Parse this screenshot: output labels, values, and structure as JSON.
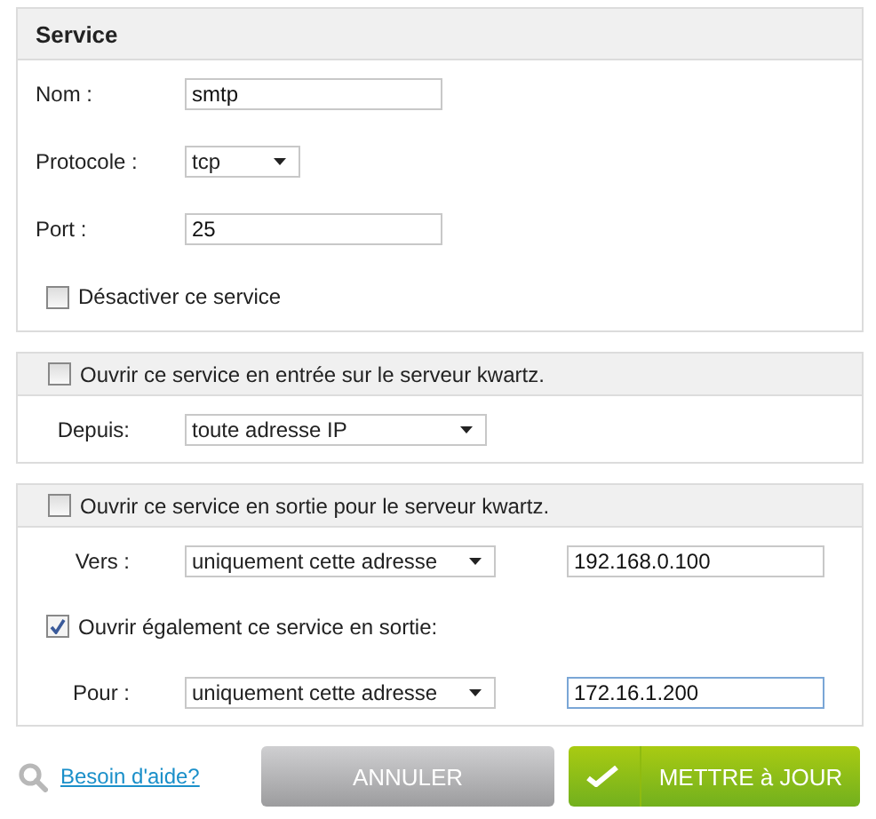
{
  "service_panel": {
    "title": "Service",
    "fields": [
      {
        "kind": "text",
        "label": "Nom :",
        "value": "smtp"
      },
      {
        "kind": "select",
        "label": "Protocole :",
        "value": "tcp"
      },
      {
        "kind": "text",
        "label": "Port :",
        "value": "25"
      }
    ],
    "disable_checkbox": {
      "label": "Désactiver ce service",
      "checked": false
    }
  },
  "inbound_panel": {
    "checkbox": {
      "label": "Ouvrir ce service en entrée sur le serveur kwartz.",
      "checked": false
    },
    "rows": [
      {
        "kind": "source",
        "label": "Depuis:",
        "select": "toute adresse IP"
      }
    ]
  },
  "outbound_panel": {
    "checkbox": {
      "label": "Ouvrir ce service en sortie pour le serveur kwartz.",
      "checked": false
    },
    "rows": [
      {
        "kind": "address",
        "label": "Vers :",
        "select": "uniquement cette adresse",
        "address": "192.168.0.100",
        "focused": false
      },
      {
        "kind": "checkbox",
        "label": "Ouvrir également ce service en sortie:",
        "checked": true
      },
      {
        "kind": "address",
        "label": "Pour :",
        "select": "uniquement cette adresse",
        "address": "172.16.1.200",
        "focused": true
      }
    ]
  },
  "help_link": "Besoin d'aide?",
  "buttons": [
    {
      "kind": "cancel",
      "label": "ANNULER"
    },
    {
      "kind": "submit",
      "label": "METTRE à JOUR"
    }
  ]
}
